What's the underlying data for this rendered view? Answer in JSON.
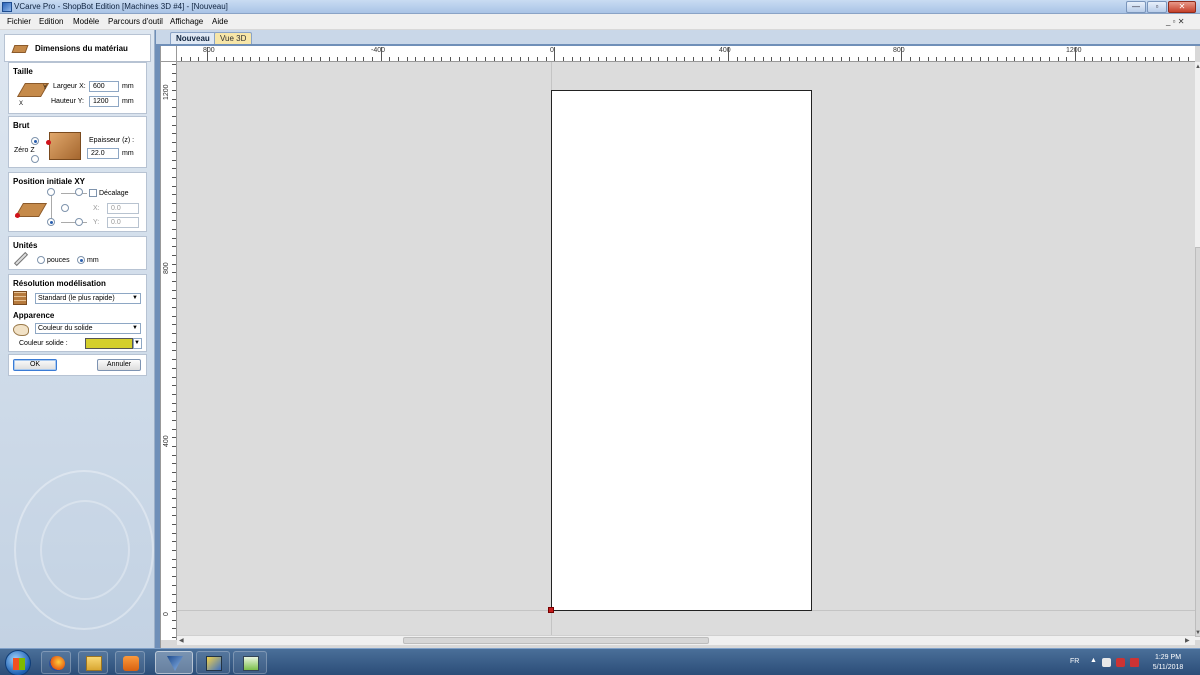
{
  "window": {
    "title": "VCarve Pro - ShopBot Edition [Machines 3D #4] - [Nouveau]",
    "minimize_label": "—",
    "maximize_label": "▫",
    "close_label": "✕"
  },
  "menu": {
    "items": [
      "Fichier",
      "Edition",
      "Modèle",
      "Parcours d'outil",
      "Affichage",
      "Aide"
    ],
    "mdi_controls": "_ ▫ ✕"
  },
  "panel": {
    "title": "Dimensions du matériau",
    "taille": {
      "title": "Taille",
      "width_label": "Largeur X:",
      "width_value": "600",
      "width_unit": "mm",
      "height_label": "Hauteur Y:",
      "height_value": "1200",
      "height_unit": "mm",
      "icon_x": "X",
      "icon_y": "Y"
    },
    "brut": {
      "title": "Brut",
      "zero_label": "Zéro Z",
      "thickness_label": "Epaisseur (z) :",
      "thickness_value": "22.0",
      "thickness_unit": "mm"
    },
    "position": {
      "title": "Position initiale XY",
      "offset_label": "Décalage",
      "x_label": "X:",
      "x_value": "0.0",
      "y_label": "Y:",
      "y_value": "0.0"
    },
    "units": {
      "title": "Unités",
      "inches_label": "pouces",
      "mm_label": "mm",
      "selected": "mm"
    },
    "resolution": {
      "title": "Résolution modélisation",
      "selected": "Standard (le plus rapide)"
    },
    "appearance": {
      "title": "Apparence",
      "selected": "Couleur du solide",
      "solid_color_label": "Couleur solide :",
      "solid_color": "#d4cf2c"
    },
    "ok_label": "OK",
    "cancel_label": "Annuler"
  },
  "doc_tabs": [
    {
      "label": "Nouveau",
      "active": true
    },
    {
      "label": "Vue 3D",
      "active": false
    }
  ],
  "rulers": {
    "horizontal": [
      "800",
      "-400",
      "0",
      "400",
      "800",
      "1200"
    ],
    "vertical": [
      "1200",
      "800",
      "400",
      "0"
    ]
  },
  "taskbar": {
    "language": "FR",
    "time": "1:29 PM",
    "date": "5/11/2018"
  },
  "colors": {
    "origin_marker": "#c41a1a",
    "material_fill": "#ffffff",
    "canvas_bg": "#dcdcdc"
  }
}
